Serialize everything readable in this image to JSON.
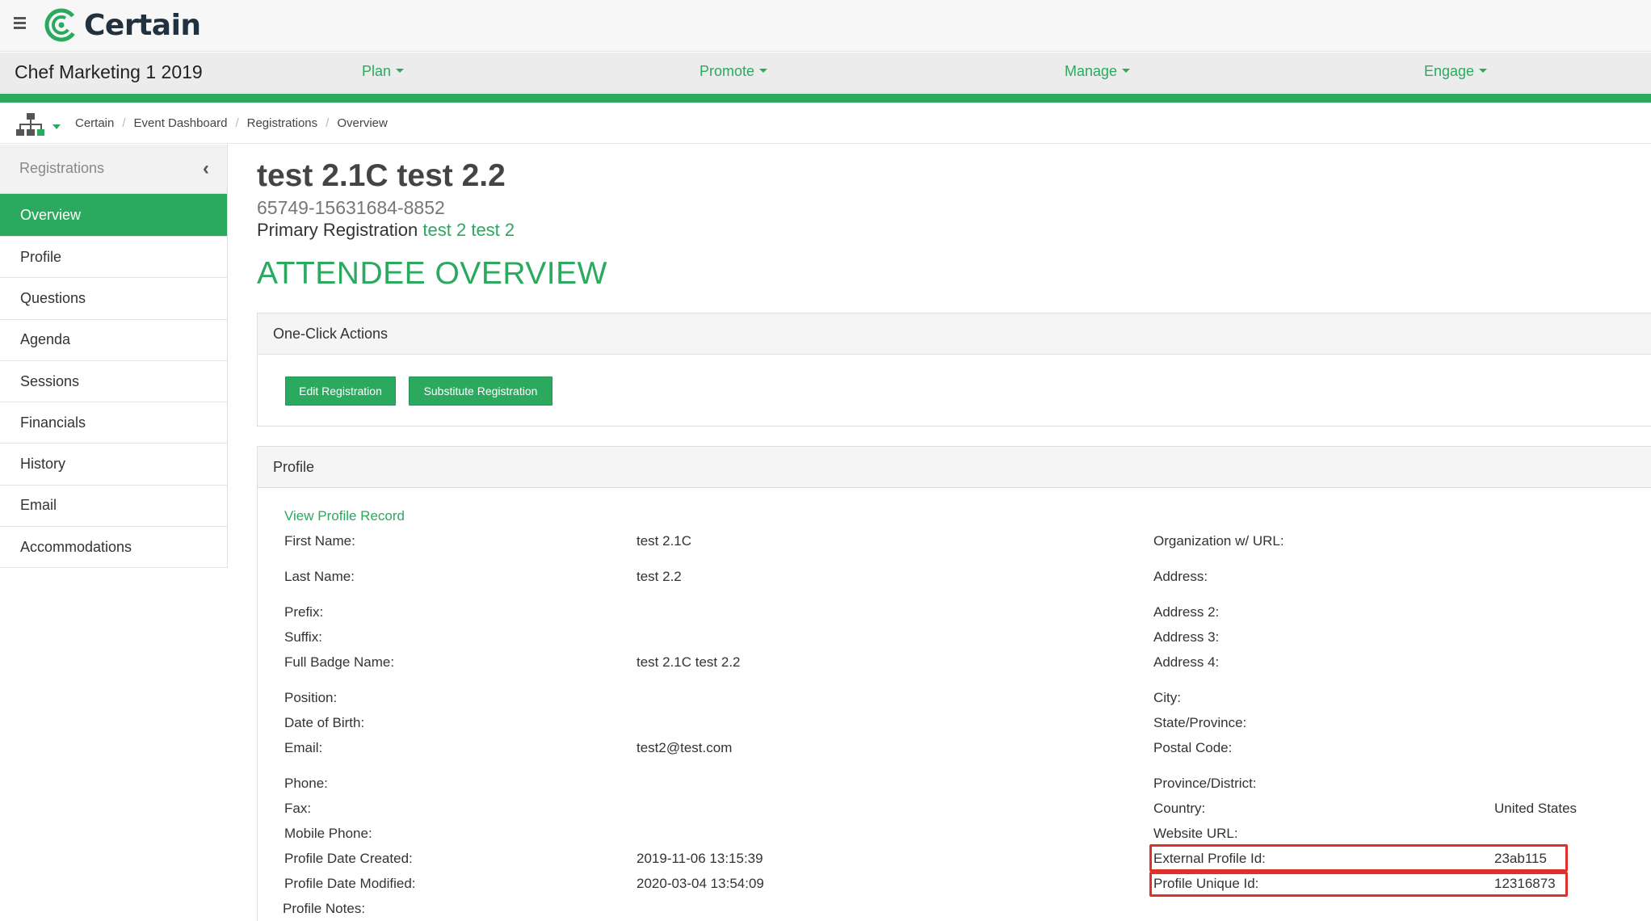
{
  "app": {
    "logo_text": "Certain"
  },
  "event": {
    "title": "Chef Marketing 1 2019"
  },
  "nav": [
    {
      "label": "Plan"
    },
    {
      "label": "Promote"
    },
    {
      "label": "Manage"
    },
    {
      "label": "Engage"
    }
  ],
  "breadcrumb": [
    "Certain",
    "Event Dashboard",
    "Registrations",
    "Overview"
  ],
  "sidebar": {
    "title": "Registrations",
    "items": [
      {
        "label": "Overview",
        "active": true
      },
      {
        "label": "Profile"
      },
      {
        "label": "Questions"
      },
      {
        "label": "Agenda"
      },
      {
        "label": "Sessions"
      },
      {
        "label": "Financials"
      },
      {
        "label": "History"
      },
      {
        "label": "Email"
      },
      {
        "label": "Accommodations"
      }
    ]
  },
  "attendee": {
    "name": "test 2.1C test 2.2",
    "registration_code": "65749-15631684-8852",
    "primary_label": "Primary Registration",
    "primary_name": "test 2 test 2"
  },
  "section_title": "ATTENDEE OVERVIEW",
  "one_click": {
    "title": "One-Click Actions",
    "edit_label": "Edit Registration",
    "substitute_label": "Substitute Registration"
  },
  "profile": {
    "title": "Profile",
    "view_link": "View Profile Record",
    "left": [
      {
        "label": "First Name:",
        "value": "test 2.1C"
      },
      {
        "label": "Last Name:",
        "value": "test 2.2"
      },
      {
        "label": "Prefix:",
        "value": ""
      },
      {
        "label": "Suffix:",
        "value": ""
      },
      {
        "label": "Full Badge Name:",
        "value": "test 2.1C test 2.2"
      },
      {
        "label": "Position:",
        "value": ""
      },
      {
        "label": "Date of Birth:",
        "value": ""
      },
      {
        "label": "Email:",
        "value": "test2@test.com"
      },
      {
        "label": "Phone:",
        "value": ""
      },
      {
        "label": "Fax:",
        "value": ""
      },
      {
        "label": "Mobile Phone:",
        "value": ""
      },
      {
        "label": "Profile Date Created:",
        "value": "2019-11-06 13:15:39"
      },
      {
        "label": "Profile Date Modified:",
        "value": "2020-03-04 13:54:09"
      },
      {
        "label": "Profile Notes:",
        "value": ""
      }
    ],
    "right": [
      {
        "label": "Organization w/ URL:",
        "value": ""
      },
      {
        "label": "Address:",
        "value": ""
      },
      {
        "label": "Address 2:",
        "value": ""
      },
      {
        "label": "Address 3:",
        "value": ""
      },
      {
        "label": "Address 4:",
        "value": ""
      },
      {
        "label": "City:",
        "value": ""
      },
      {
        "label": "State/Province:",
        "value": ""
      },
      {
        "label": "Postal Code:",
        "value": ""
      },
      {
        "label": "Province/District:",
        "value": ""
      },
      {
        "label": "Country:",
        "value": "United States"
      },
      {
        "label": "Website URL:",
        "value": ""
      },
      {
        "label": "External Profile Id:",
        "value": "23ab115"
      },
      {
        "label": "Profile Unique Id:",
        "value": "12316873"
      }
    ]
  },
  "colors": {
    "accent": "#2aa95f",
    "highlight": "#e0302a"
  },
  "icons": {
    "menu": "hamburger-icon",
    "logo": "certain-logo-icon",
    "hierarchy": "hierarchy-icon",
    "collapse": "chevron-left-icon",
    "dropdown": "caret-down-icon"
  }
}
